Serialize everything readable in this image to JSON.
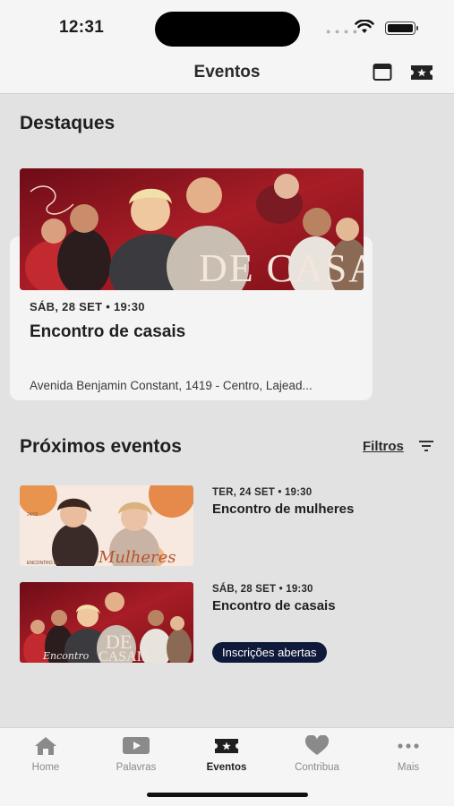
{
  "status_bar": {
    "time": "12:31"
  },
  "header": {
    "title": "Eventos",
    "icons": [
      "calendar-icon",
      "ticket-icon"
    ]
  },
  "highlights": {
    "title": "Destaques",
    "featured": {
      "image_text": "DE CASAIS",
      "date": "SÁB, 28 SET • 19:30",
      "name": "Encontro de casais",
      "address": "Avenida Benjamin Constant, 1419 - Centro, Lajead..."
    }
  },
  "upcoming": {
    "title": "Próximos eventos",
    "filters_label": "Filtros",
    "events": [
      {
        "date": "TER, 24 SET • 19:30",
        "name": "Encontro de mulheres",
        "image_text": "Mulheres",
        "image_caption": "ENCONTRO DE",
        "image_date": "24/09"
      },
      {
        "date": "SÁB, 28 SET • 19:30",
        "name": "Encontro de casais",
        "image_text": "CASAIS",
        "image_caption": "Encontro",
        "image_big": "DE",
        "badge": "Inscrições abertas"
      }
    ]
  },
  "tab_bar": {
    "tabs": [
      {
        "label": "Home",
        "icon": "home-icon",
        "active": false
      },
      {
        "label": "Palavras",
        "icon": "video-play-icon",
        "active": false
      },
      {
        "label": "Eventos",
        "icon": "ticket-icon",
        "active": true
      },
      {
        "label": "Contribua",
        "icon": "heart-icon",
        "active": false
      },
      {
        "label": "Mais",
        "icon": "more-dots-icon",
        "active": false
      }
    ]
  },
  "colors": {
    "background": "#e2e2e2",
    "card": "#f4f4f4",
    "badge": "#0f1a3a",
    "text": "#1f1f1f",
    "muted": "#8a8a8a"
  }
}
